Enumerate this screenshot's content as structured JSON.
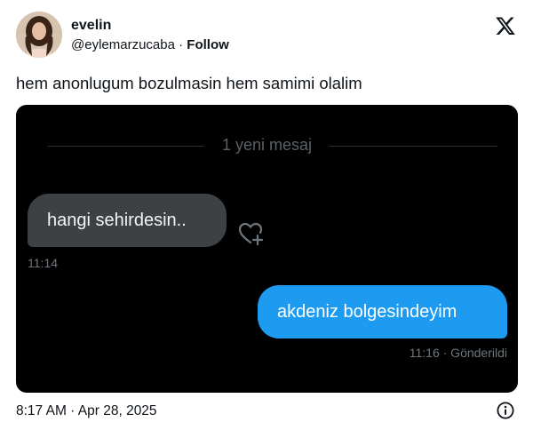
{
  "author": {
    "name": "evelin",
    "handle": "@eylemarzucaba",
    "separator": "·",
    "follow_label": "Follow"
  },
  "tweet": {
    "text": "hem anonlugum bozulmasin hem samimi olalim",
    "timestamp": "8:17 AM · Apr 28, 2025"
  },
  "chat": {
    "divider_text": "1 yeni mesaj",
    "messages": [
      {
        "direction": "incoming",
        "text": "hangi sehirdesin..",
        "time": "11:14"
      },
      {
        "direction": "outgoing",
        "text": "akdeniz bolgesindeyim",
        "time": "11:16",
        "status": "· Gönderildi"
      }
    ]
  },
  "icons": {
    "logo": "x-logo-icon",
    "react": "heart-plus-icon",
    "info": "info-icon"
  },
  "colors": {
    "chat_bg": "#000000",
    "incoming_bubble": "#3e4144",
    "outgoing_bubble": "#1d9bf0"
  }
}
